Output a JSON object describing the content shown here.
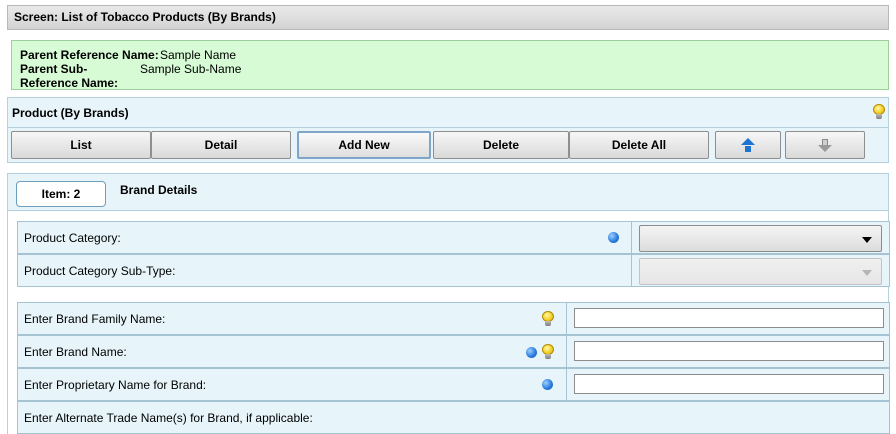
{
  "screen": {
    "title": "Screen: List of Tobacco Products (By Brands)"
  },
  "parent": {
    "reference_label": "Parent Reference Name:",
    "reference_value": "Sample Name",
    "sub_reference_label": "Parent Sub-Reference Name:",
    "sub_reference_value": "Sample Sub-Name"
  },
  "section": {
    "title": "Product (By Brands)",
    "help_icon": "lightbulb-icon"
  },
  "toolbar": {
    "list_label": "List",
    "detail_label": "Detail",
    "add_new_label": "Add New",
    "delete_label": "Delete",
    "delete_all_label": "Delete All",
    "move_up_icon": "arrow-up-icon",
    "move_down_icon": "arrow-down-icon"
  },
  "item": {
    "tab_label": "Item: 2",
    "title": "Brand Details"
  },
  "form": {
    "fields": [
      {
        "label": "Product Category:",
        "required": true,
        "help": false,
        "control": "select",
        "value": ""
      },
      {
        "label": "Product Category Sub-Type:",
        "required": false,
        "help": false,
        "control": "select-disabled",
        "value": ""
      },
      {
        "label": "Enter Brand Family Name:",
        "required": false,
        "help": true,
        "control": "text",
        "value": ""
      },
      {
        "label": "Enter Brand Name:",
        "required": true,
        "help": true,
        "control": "text",
        "value": ""
      },
      {
        "label": "Enter Proprietary Name for Brand:",
        "required": true,
        "help": false,
        "control": "text",
        "value": ""
      },
      {
        "label": "Enter Alternate Trade Name(s) for Brand, if applicable:",
        "required": false,
        "help": false,
        "control": "none",
        "value": ""
      }
    ]
  },
  "colors": {
    "header_gray": "#d3d3d3",
    "parent_green": "#d6fbd5",
    "panel_blue": "#e7f5fb",
    "required_dot": "#2c7fe0",
    "up_arrow": "#1f74d1"
  }
}
